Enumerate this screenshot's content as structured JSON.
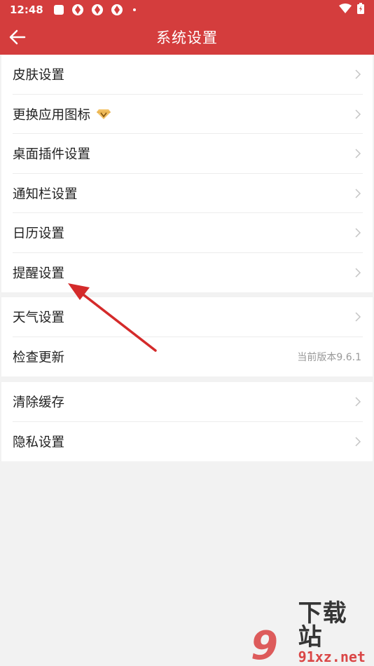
{
  "status_bar": {
    "time": "12:48"
  },
  "header": {
    "title": "系统设置"
  },
  "groups": [
    {
      "items": [
        {
          "label": "皮肤设置"
        },
        {
          "label": "更换应用图标"
        },
        {
          "label": "桌面插件设置"
        },
        {
          "label": "通知栏设置"
        },
        {
          "label": "日历设置"
        },
        {
          "label": "提醒设置"
        }
      ]
    },
    {
      "items": [
        {
          "label": "天气设置"
        },
        {
          "label": "检查更新",
          "value": "当前版本9.6.1"
        }
      ]
    },
    {
      "items": [
        {
          "label": "清除缓存"
        },
        {
          "label": "隐私设置"
        }
      ]
    }
  ],
  "watermark": {
    "logo": "9",
    "cn": "下载站",
    "en": "91xz.net"
  },
  "colors": {
    "header_bg": "#d43d3d",
    "page_bg": "#f2f2f2",
    "annotation_arrow": "#d42a2a"
  }
}
